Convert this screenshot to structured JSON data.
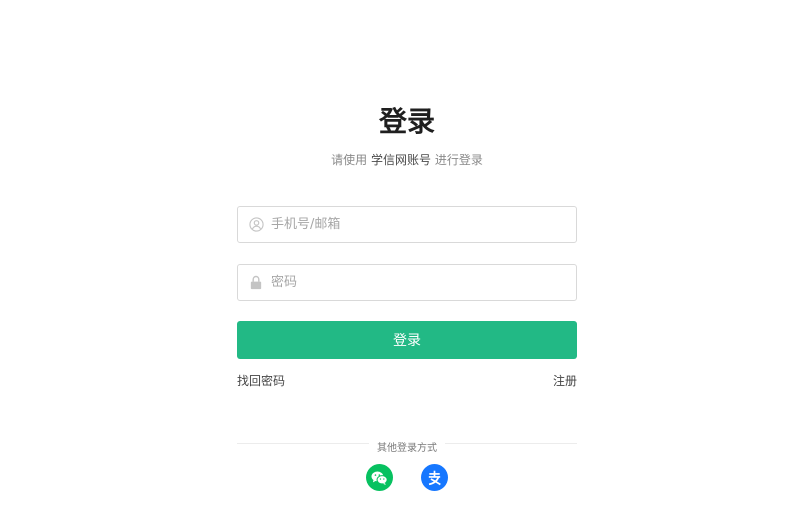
{
  "header": {
    "title": "登录",
    "subtitle_prefix": "请使用 ",
    "subtitle_brand": "学信网账号",
    "subtitle_suffix": " 进行登录"
  },
  "form": {
    "username": {
      "placeholder": "手机号/邮箱",
      "value": "",
      "icon": "user-icon"
    },
    "password": {
      "placeholder": "密码",
      "value": "",
      "icon": "lock-icon"
    },
    "submit_label": "登录"
  },
  "links": {
    "forgot_password": "找回密码",
    "register": "注册"
  },
  "other_login": {
    "label": "其他登录方式",
    "methods": [
      {
        "name": "wechat",
        "icon": "wechat-icon",
        "color": "#07c160"
      },
      {
        "name": "alipay",
        "icon": "alipay-icon",
        "color": "#1677ff"
      }
    ]
  },
  "colors": {
    "primary": "#22b985",
    "border": "#d9d9d9"
  }
}
